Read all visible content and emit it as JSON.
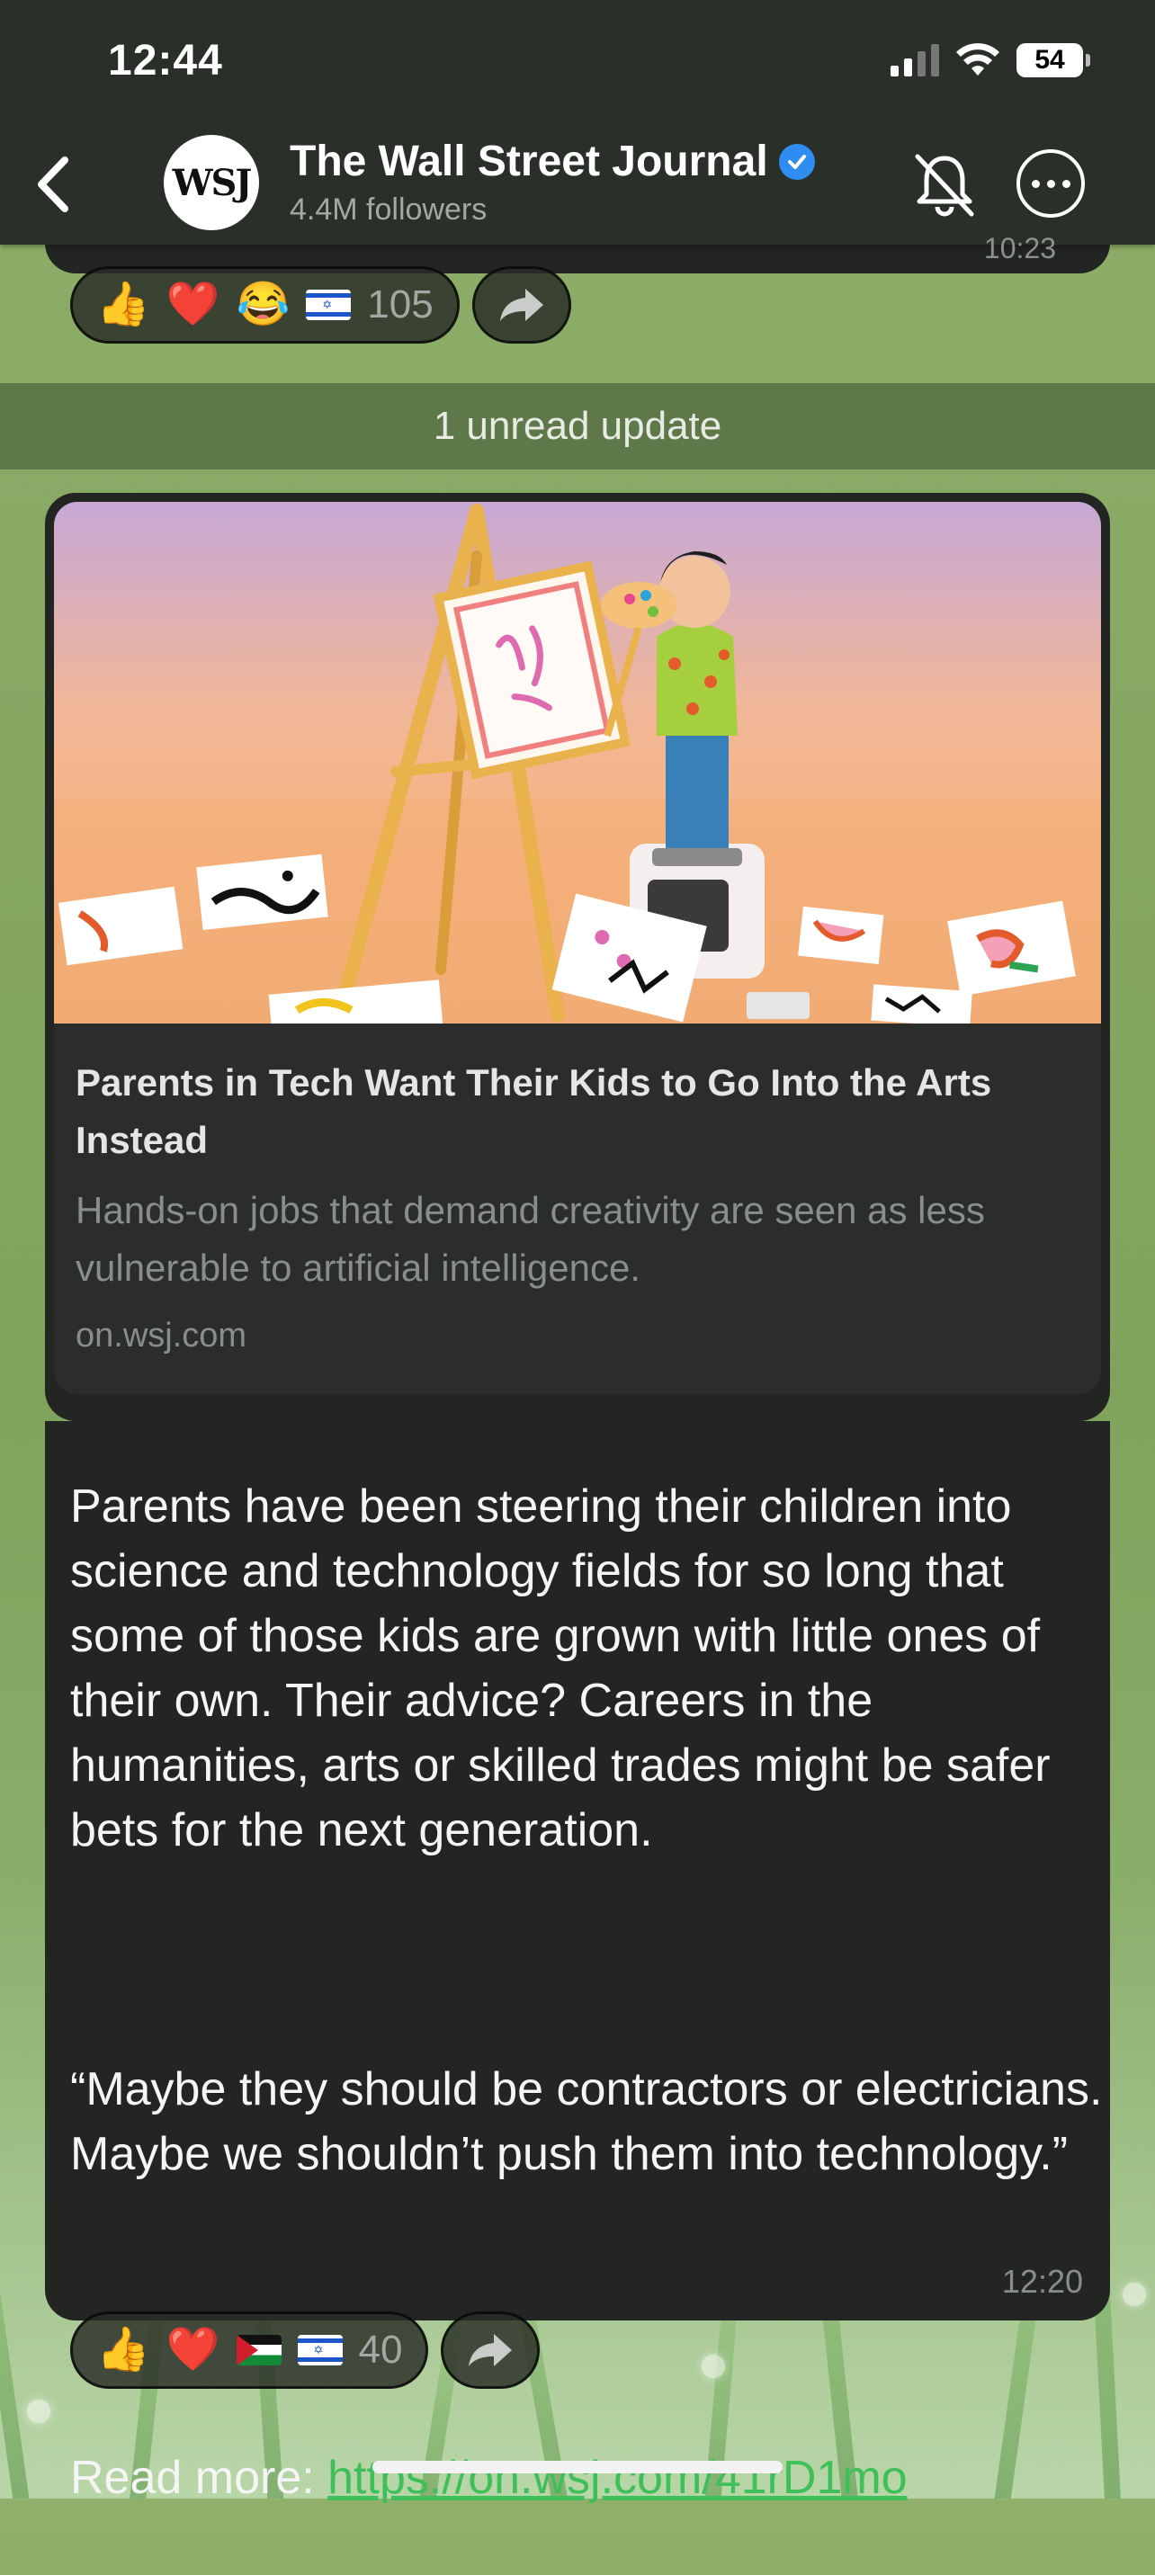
{
  "status_bar": {
    "time": "12:44",
    "battery": "54"
  },
  "header": {
    "avatar_text": "WSJ",
    "title": "The Wall Street Journal",
    "followers": "4.4M followers"
  },
  "previous_message": {
    "time": "10:23",
    "reactions": {
      "emojis": [
        "👍",
        "❤️",
        "😂"
      ],
      "flags": [
        "israel-flag"
      ],
      "count": "105"
    }
  },
  "unread_banner": "1 unread update",
  "message": {
    "link_preview": {
      "title": "Parents in Tech Want Their Kids to Go Into the Arts Instead",
      "description": "Hands-on jobs that demand creativity are seen as less vulnerable to artificial intelligence.",
      "domain": "on.wsj.com",
      "image_alt": "clay figure painting at an easel"
    },
    "paragraph_1": "Parents have been steering their children into science and technology fields for so long that some of those kids are grown with little ones of their own. Their advice? Careers in the humanities, arts or skilled trades might be safer bets for the next generation.",
    "paragraph_2": "“Maybe they should be contractors or electricians. Maybe we shouldn’t push them into technology.”",
    "read_more_label": "Read more: ",
    "read_more_url": "https://on.wsj.com/41rD1mo",
    "time": "12:20",
    "reactions": {
      "emojis": [
        "👍",
        "❤️"
      ],
      "flags": [
        "palestine-flag",
        "israel-flag"
      ],
      "count": "40"
    }
  },
  "colors": {
    "accent_link": "#3fbf5a",
    "verified": "#2f8cf0",
    "bubble": "#232523"
  }
}
